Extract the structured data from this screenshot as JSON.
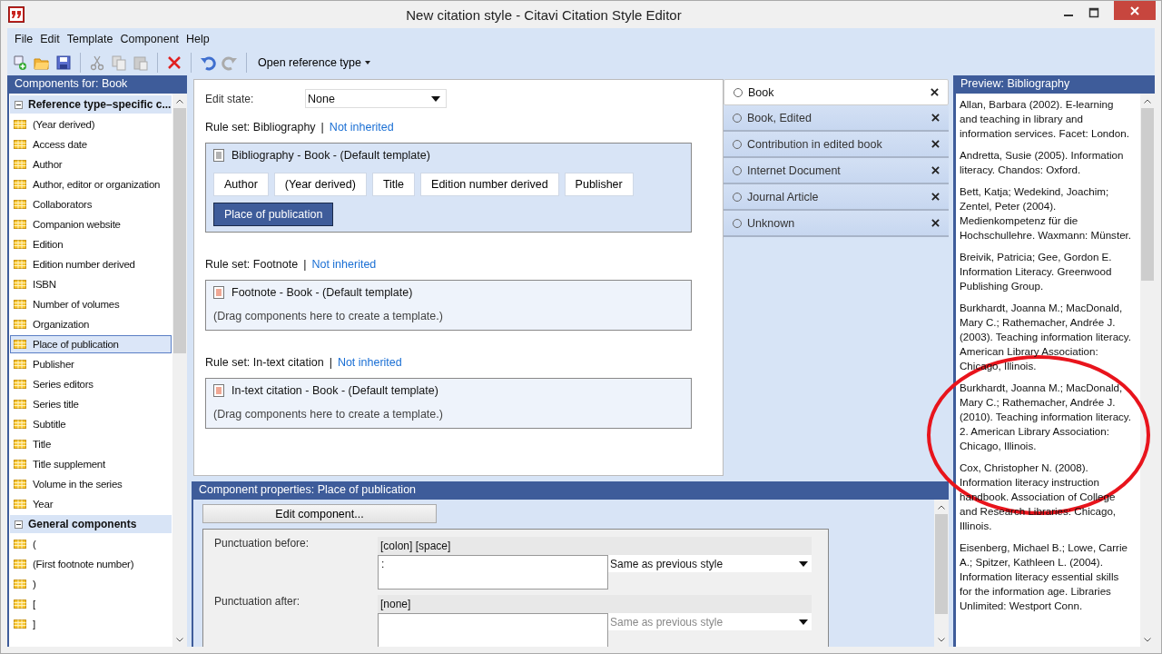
{
  "window": {
    "title": "New citation style - Citavi Citation Style Editor"
  },
  "menu": [
    "File",
    "Edit",
    "Template",
    "Component",
    "Help"
  ],
  "toolbar": {
    "dropdown": "Open reference type"
  },
  "components_panel": {
    "title": "Components for: Book",
    "groups": [
      {
        "label": "Reference type–specific c...",
        "expanded": true,
        "items": [
          {
            "label": "(Year derived)",
            "selected": false
          },
          {
            "label": "Access date",
            "selected": false
          },
          {
            "label": "Author",
            "selected": false
          },
          {
            "label": "Author, editor or organization",
            "selected": false
          },
          {
            "label": "Collaborators",
            "selected": false
          },
          {
            "label": "Companion website",
            "selected": false
          },
          {
            "label": "Edition",
            "selected": false
          },
          {
            "label": "Edition number derived",
            "selected": false
          },
          {
            "label": "ISBN",
            "selected": false
          },
          {
            "label": "Number of volumes",
            "selected": false
          },
          {
            "label": "Organization",
            "selected": false
          },
          {
            "label": "Place of publication",
            "selected": true
          },
          {
            "label": "Publisher",
            "selected": false
          },
          {
            "label": "Series editors",
            "selected": false
          },
          {
            "label": "Series title",
            "selected": false
          },
          {
            "label": "Subtitle",
            "selected": false
          },
          {
            "label": "Title",
            "selected": false
          },
          {
            "label": "Title supplement",
            "selected": false
          },
          {
            "label": "Volume in the series",
            "selected": false
          },
          {
            "label": "Year",
            "selected": false
          }
        ]
      },
      {
        "label": "General components",
        "expanded": true,
        "items": [
          {
            "label": "(",
            "selected": false
          },
          {
            "label": "(First footnote number)",
            "selected": false
          },
          {
            "label": ")",
            "selected": false
          },
          {
            "label": "[",
            "selected": false
          },
          {
            "label": "]",
            "selected": false
          }
        ]
      }
    ]
  },
  "edit_state": {
    "label": "Edit state:",
    "value": "None"
  },
  "rule_sets": [
    {
      "label": "Rule set: Bibliography",
      "separator": "|",
      "link": "Not inherited",
      "template": "Bibliography - Book - (Default template)",
      "kind": "bibliography",
      "components": [
        {
          "label": "Author",
          "selected": false
        },
        {
          "label": "(Year derived)",
          "selected": false
        },
        {
          "label": "Title",
          "selected": false
        },
        {
          "label": "Edition number derived",
          "selected": false
        },
        {
          "label": "Publisher",
          "selected": false
        },
        {
          "label": "Place of publication",
          "selected": true
        }
      ]
    },
    {
      "label": "Rule set: Footnote",
      "separator": "|",
      "link": "Not inherited",
      "template": "Footnote - Book - (Default template)",
      "kind": "footnote",
      "hint": "(Drag components here to create a template.)"
    },
    {
      "label": "Rule set: In-text citation",
      "separator": "|",
      "link": "Not inherited",
      "template": "In-text citation - Book - (Default template)",
      "kind": "intext",
      "hint": "(Drag components here to create a template.)"
    }
  ],
  "reference_types": [
    {
      "label": "Book",
      "selected": true
    },
    {
      "label": "Book, Edited",
      "selected": false
    },
    {
      "label": "Contribution in edited book",
      "selected": false
    },
    {
      "label": "Internet Document",
      "selected": false
    },
    {
      "label": "Journal Article",
      "selected": false
    },
    {
      "label": "Unknown",
      "selected": false
    }
  ],
  "properties": {
    "title": "Component properties:  Place of publication",
    "edit_button": "Edit component...",
    "fields": [
      {
        "label": "Punctuation before:",
        "code": "[colon] [space]",
        "value": ":",
        "style": "Same as previous style",
        "disabled": false
      },
      {
        "label": "Punctuation after:",
        "code": "[none]",
        "style": "Same as previous style",
        "disabled": true
      }
    ]
  },
  "preview": {
    "title": "Preview: Bibliography",
    "entries": [
      "Allan, Barbara (2002). E-learning and teaching in library and information services. Facet: London.",
      "Andretta, Susie (2005). Information literacy. Chandos: Oxford.",
      "Bett, Katja; Wedekind, Joachim; Zentel, Peter (2004). Medienkompetenz für die Hochschullehre. Waxmann: Münster.",
      "Breivik, Patricia; Gee, Gordon E. Information Literacy. Greenwood Publishing Group.",
      "Burkhardt, Joanna M.; MacDonald, Mary C.; Rathemacher, Andrée J. (2003). Teaching information literacy. American Library Association: Chicago, Illinois.",
      "Burkhardt, Joanna M.; MacDonald, Mary C.; Rathemacher, Andrée J. (2010). Teaching information literacy. 2. American Library Association: Chicago, Illinois.",
      "Cox, Christopher N. (2008). Information literacy instruction handbook. Association of College and Research Libraries: Chicago, Illinois.",
      "Eisenberg, Michael B.; Lowe, Carrie A.; Spitzer, Kathleen L. (2004). Information literacy essential skills for the information age. Libraries Unlimited: Westport Conn."
    ]
  }
}
